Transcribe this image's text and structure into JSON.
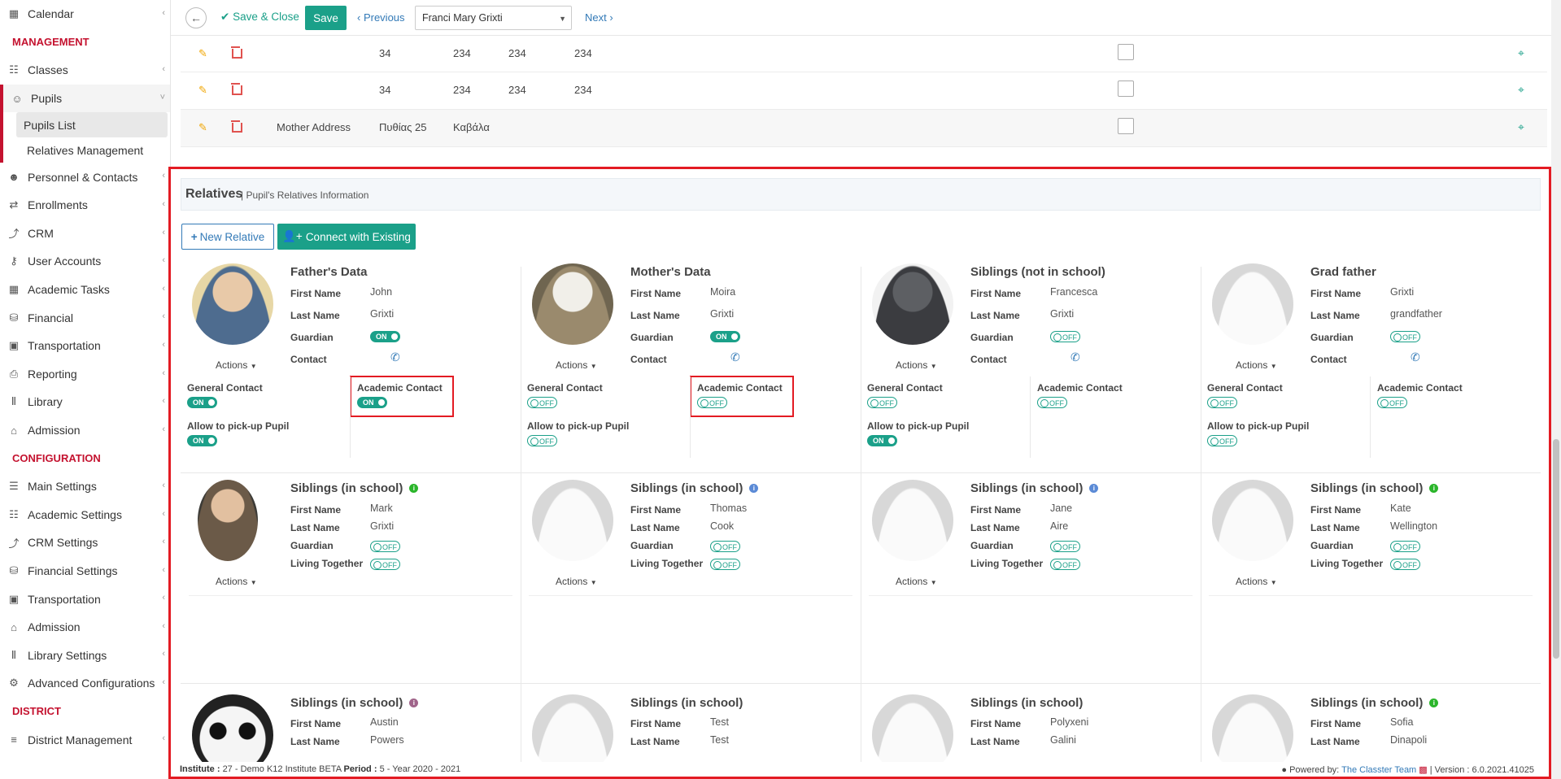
{
  "sidebar": {
    "items": [
      {
        "label": "Calendar",
        "icon": "calendar-icon",
        "chev": true
      },
      {
        "section": "MANAGEMENT"
      },
      {
        "label": "Classes",
        "icon": "classes-icon",
        "chev": true
      },
      {
        "label": "Pupils",
        "icon": "pupils-icon",
        "chev": "down",
        "active": true
      },
      {
        "sub": "Pupils List",
        "selected": true
      },
      {
        "sub": "Relatives Management"
      },
      {
        "label": "Personnel & Contacts",
        "icon": "person-icon",
        "chev": true
      },
      {
        "label": "Enrollments",
        "icon": "swap-icon",
        "chev": true
      },
      {
        "label": "CRM",
        "icon": "crm-icon",
        "chev": true
      },
      {
        "label": "User Accounts",
        "icon": "key-icon",
        "chev": true
      },
      {
        "label": "Academic Tasks",
        "icon": "grid-icon",
        "chev": true
      },
      {
        "label": "Financial",
        "icon": "coins-icon",
        "chev": true
      },
      {
        "label": "Transportation",
        "icon": "bus-icon",
        "chev": true
      },
      {
        "label": "Reporting",
        "icon": "print-icon",
        "chev": true
      },
      {
        "label": "Library",
        "icon": "books-icon",
        "chev": true
      },
      {
        "label": "Admission",
        "icon": "bank-icon",
        "chev": true
      },
      {
        "section": "CONFIGURATION"
      },
      {
        "label": "Main Settings",
        "icon": "sliders-icon",
        "chev": true
      },
      {
        "label": "Academic Settings",
        "icon": "classes-icon",
        "chev": true
      },
      {
        "label": "CRM Settings",
        "icon": "crm-icon",
        "chev": true
      },
      {
        "label": "Financial Settings",
        "icon": "coins-icon",
        "chev": true
      },
      {
        "label": "Transportation",
        "icon": "bus-icon",
        "chev": true
      },
      {
        "label": "Admission",
        "icon": "bank-icon",
        "chev": true
      },
      {
        "label": "Library Settings",
        "icon": "books-icon",
        "chev": true
      },
      {
        "label": "Advanced Configurations",
        "icon": "gears-icon",
        "chev": true
      },
      {
        "section": "DISTRICT"
      },
      {
        "label": "District Management",
        "icon": "list-icon",
        "chev": true
      }
    ]
  },
  "toolbar": {
    "save_close": "Save & Close",
    "save": "Save",
    "previous": "Previous",
    "pupil_select": "Franci Mary Grixti",
    "next": "Next"
  },
  "addresses": [
    {
      "type": "",
      "col1": "34",
      "col2": "234",
      "col3": "234",
      "col4": "234"
    },
    {
      "type": "",
      "col1": "34",
      "col2": "234",
      "col3": "234",
      "col4": "234"
    },
    {
      "type": "Mother Address",
      "col1": "Πυθίας 25",
      "col2": "Καβάλα",
      "col3": "",
      "col4": ""
    }
  ],
  "relatives": {
    "title": "Relatives",
    "subtitle": "| Pupil's Relatives Information",
    "new_relative": "New Relative",
    "connect_existing": "Connect with Existing",
    "labels": {
      "first_name": "First Name",
      "last_name": "Last Name",
      "guardian": "Guardian",
      "contact": "Contact",
      "living_together": "Living Together",
      "actions": "Actions",
      "general_contact": "General Contact",
      "academic_contact": "Academic Contact",
      "allow_pickup": "Allow to pick-up Pupil",
      "on": "ON",
      "off": "OFF"
    },
    "parents": [
      {
        "title": "Father's Data",
        "first": "John",
        "last": "Grixti",
        "guardian": "on",
        "general": "on",
        "academic": "on",
        "pickup": "on",
        "highlight": true
      },
      {
        "title": "Mother's Data",
        "first": "Moira",
        "last": "Grixti",
        "guardian": "on",
        "general": "off",
        "academic": "off",
        "pickup": "off",
        "highlight": true
      },
      {
        "title": "Siblings (not in school)",
        "first": "Francesca",
        "last": "Grixti",
        "guardian": "off",
        "general": "off",
        "academic": "off",
        "pickup": "on",
        "highlight": false
      },
      {
        "title": "Grad father",
        "first": "Grixti",
        "last": "grandfather",
        "guardian": "off",
        "general": "off",
        "academic": "off",
        "pickup": "off",
        "highlight": false
      }
    ],
    "siblings_row1": [
      {
        "title": "Siblings (in school)",
        "dot": "#2bb52b",
        "first": "Mark",
        "last": "Grixti",
        "guardian": "off",
        "living": "off"
      },
      {
        "title": "Siblings (in school)",
        "dot": "#5b8ad6",
        "first": "Thomas",
        "last": "Cook",
        "guardian": "off",
        "living": "off"
      },
      {
        "title": "Siblings (in school)",
        "dot": "#5b8ad6",
        "first": "Jane",
        "last": "Aire",
        "guardian": "off",
        "living": "off"
      },
      {
        "title": "Siblings (in school)",
        "dot": "#2bb52b",
        "first": "Kate",
        "last": "Wellington",
        "guardian": "off",
        "living": "off"
      }
    ],
    "siblings_row2": [
      {
        "title": "Siblings (in school)",
        "dot": "#a0648a",
        "first": "Austin",
        "last": "Powers"
      },
      {
        "title": "Siblings (in school)",
        "dot": "",
        "first": "Test",
        "last": "Test"
      },
      {
        "title": "Siblings (in school)",
        "dot": "",
        "first": "Polyxeni",
        "last": "Galini"
      },
      {
        "title": "Siblings (in school)",
        "dot": "#2bb52b",
        "first": "Sofia",
        "last": "Dinapoli"
      }
    ]
  },
  "footer": {
    "institute_label": "Institute :",
    "institute_value": "27 - Demo K12 Institute BETA",
    "period_label": "Period :",
    "period_value": "5 - Year 2020 - 2021",
    "powered_by": "Powered by:",
    "team": "The Classter Team",
    "version": "| Version : 6.0.2021.41025"
  },
  "colors": {
    "accent": "#1ba089",
    "brand_red": "#c4122f",
    "highlight_red": "#e31b23",
    "link": "#337ab7"
  }
}
